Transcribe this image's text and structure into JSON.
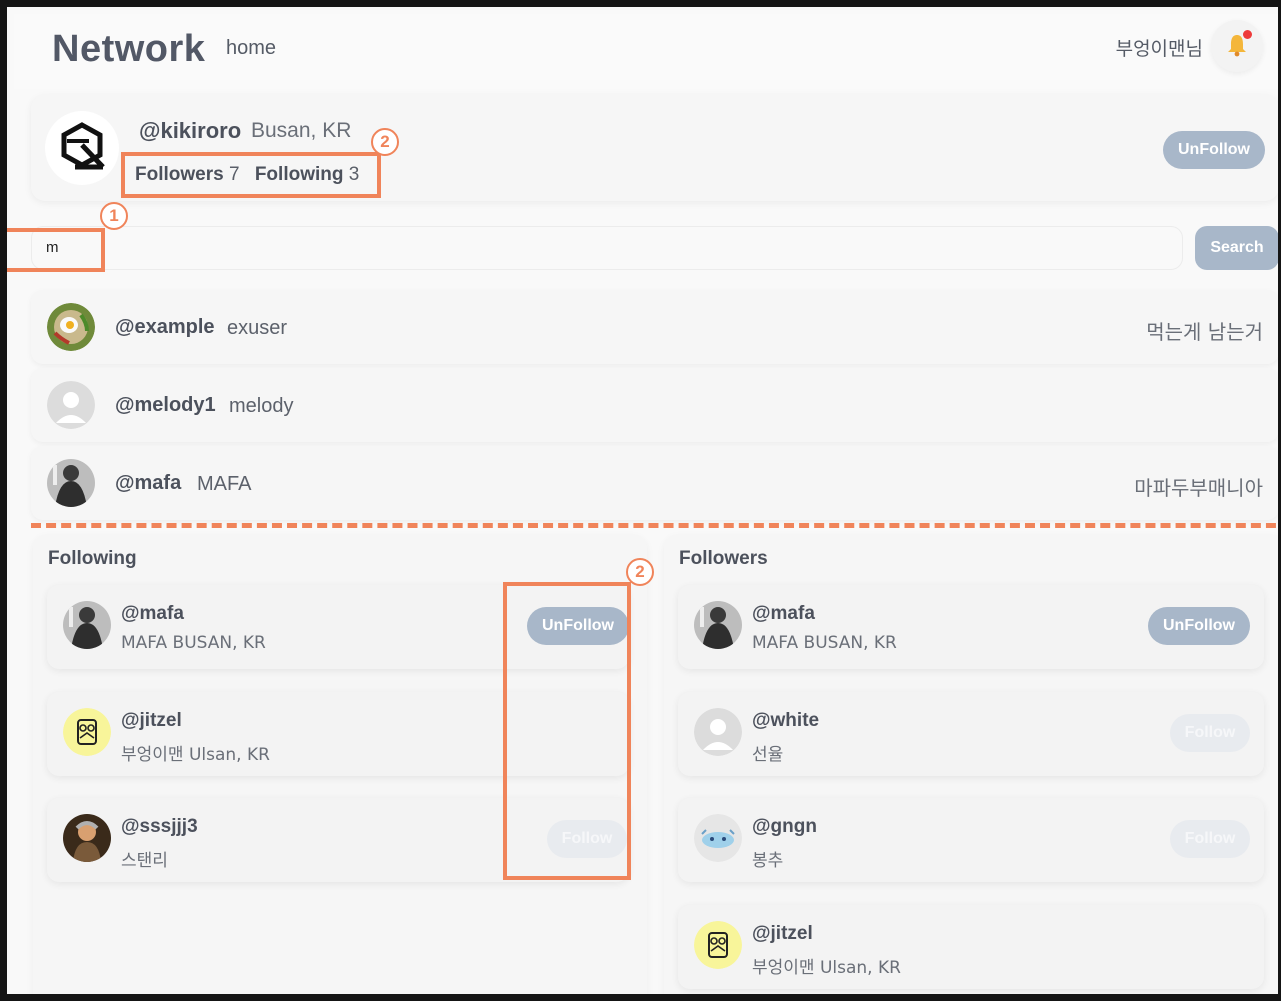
{
  "header": {
    "brand": "Network",
    "home_link": "home",
    "username": "부엉이맨님",
    "notification_icon": "bell-icon"
  },
  "profile": {
    "handle": "@kikiroro",
    "location": "Busan, KR",
    "followers_label": "Followers",
    "followers_count": "7",
    "following_label": "Following",
    "following_count": "3",
    "unfollow_label": "UnFollow"
  },
  "search": {
    "value": "m",
    "button_label": "Search"
  },
  "results": [
    {
      "handle": "@example",
      "nickname": "exuser",
      "bio": "먹는게 남는거"
    },
    {
      "handle": "@melody1",
      "nickname": "melody",
      "bio": ""
    },
    {
      "handle": "@mafa",
      "nickname": "MAFA",
      "bio": "마파두부매니아"
    }
  ],
  "following": {
    "title": "Following",
    "items": [
      {
        "handle": "@mafa",
        "sub": "MAFA BUSAN, KR",
        "button": "UnFollow"
      },
      {
        "handle": "@jitzel",
        "sub": "부엉이맨 Ulsan, KR",
        "button": ""
      },
      {
        "handle": "@sssjjj3",
        "sub": "스탠리",
        "button": "Follow"
      }
    ]
  },
  "followers": {
    "title": "Followers",
    "items": [
      {
        "handle": "@mafa",
        "sub": "MAFA BUSAN, KR",
        "button": "UnFollow"
      },
      {
        "handle": "@white",
        "sub": "선율",
        "button": "Follow"
      },
      {
        "handle": "@gngn",
        "sub": "봉추",
        "button": "Follow"
      },
      {
        "handle": "@jitzel",
        "sub": "부엉이맨 Ulsan, KR",
        "button": ""
      }
    ]
  },
  "annotations": {
    "marker_1": "1",
    "marker_2": "2"
  },
  "colors": {
    "accent_annotation": "#f0845a",
    "unfollow_button": "#a8b7c9",
    "follow_button_disabled": "#e8ebef"
  }
}
